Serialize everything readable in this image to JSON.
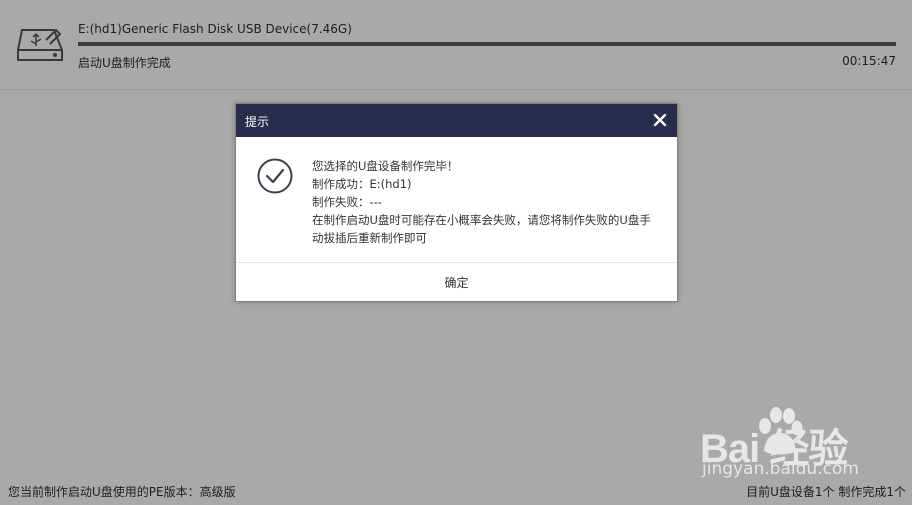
{
  "device": {
    "name": "E:(hd1)Generic Flash Disk USB Device(7.46G)",
    "status": "启动U盘制作完成",
    "time": "00:15:47",
    "progress": 1.0
  },
  "dialog": {
    "title": "提示",
    "messages": [
      "您选择的U盘设备制作完毕！",
      "制作成功：E:(hd1)",
      "制作失败：---",
      "在制作启动U盘时可能存在小概率会失败，请您将制作失败的U盘手动拔插后重新制作即可"
    ],
    "confirm_label": "确定"
  },
  "footer": {
    "left": "您当前制作启动U盘使用的PE版本：高级版",
    "right": "目前U盘设备1个 制作完成1个"
  },
  "watermark": {
    "brand": "Bai 经验",
    "url": "jingyan.baidu.com"
  },
  "colors": {
    "background": "#a8a9a9",
    "dialog_header": "#272d4a",
    "progress_fill": "#3b3c3c"
  },
  "icons": [
    "usb-drive-icon",
    "close-icon",
    "check-circle-icon",
    "paw-icon"
  ]
}
